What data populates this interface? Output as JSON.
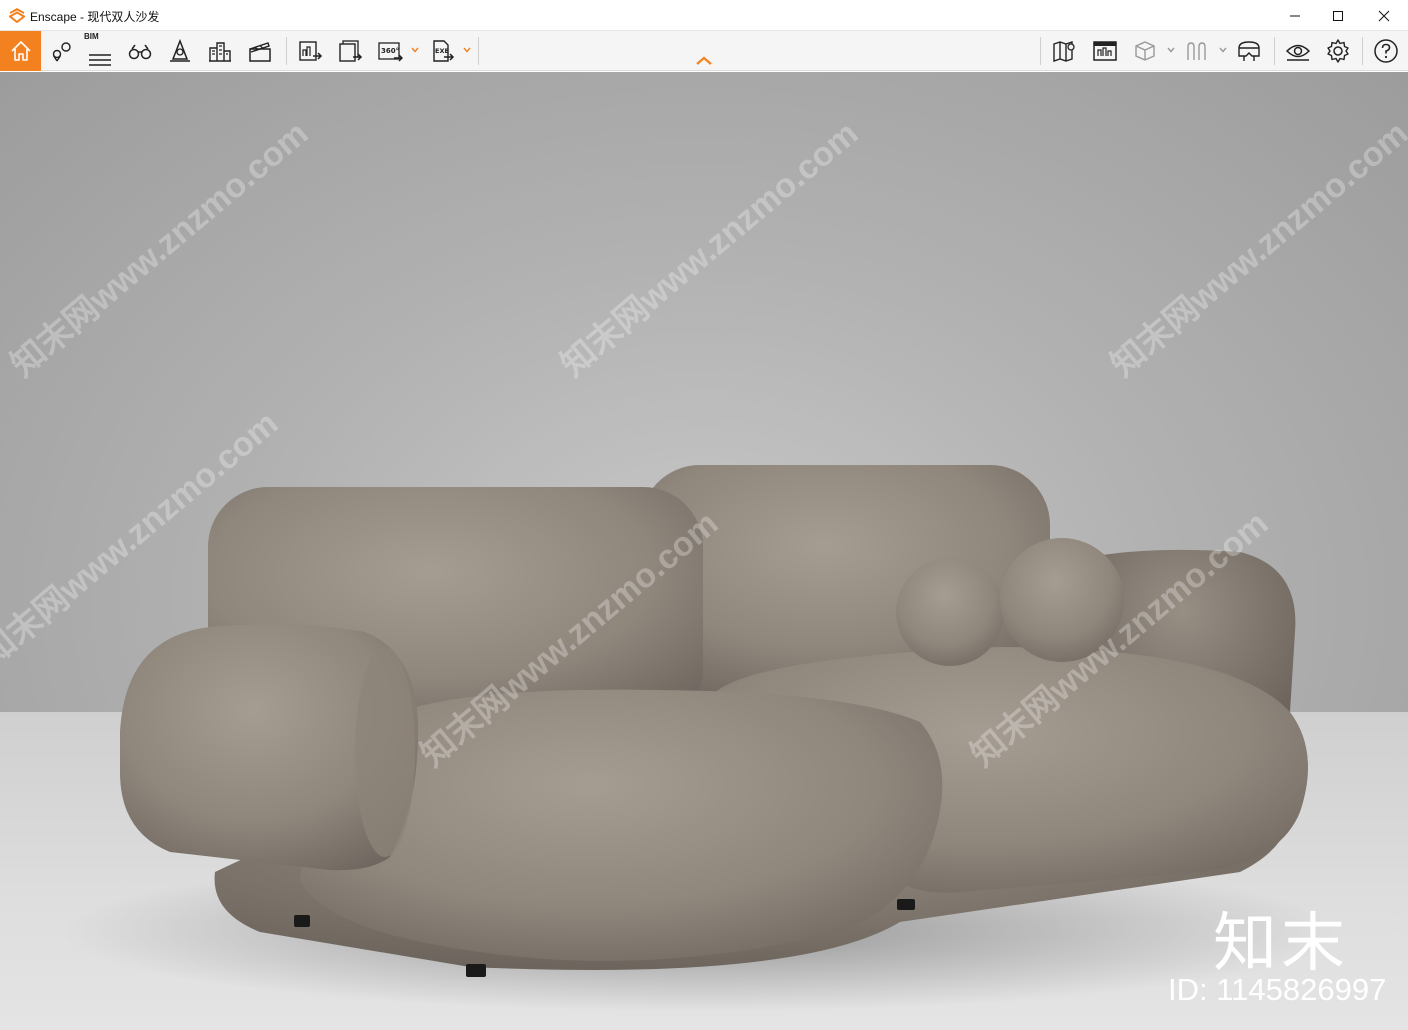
{
  "window": {
    "title": "Enscape - 现代双人沙发",
    "controls": {
      "minimize": "minimize-icon",
      "maximize": "maximize-icon",
      "close": "close-icon"
    }
  },
  "toolbar": {
    "left_tools": [
      {
        "name": "home-icon",
        "active": true
      },
      {
        "name": "location-pins-icon"
      },
      {
        "name": "bim-icon",
        "label": "BIM"
      },
      {
        "name": "binoculars-icon"
      },
      {
        "name": "traffic-cone-icon"
      },
      {
        "name": "buildings-icon"
      },
      {
        "name": "clapperboard-icon"
      },
      {
        "name": "render-screenshot-icon"
      },
      {
        "name": "batch-render-icon"
      },
      {
        "name": "export-360-icon",
        "label": "360°"
      },
      {
        "name": "export-exe-icon",
        "label": "EXE"
      }
    ],
    "right_tools": [
      {
        "name": "map-icon"
      },
      {
        "name": "web-standalone-icon"
      },
      {
        "name": "box-view-icon"
      },
      {
        "name": "sketch-view-icon"
      },
      {
        "name": "vr-headset-icon"
      },
      {
        "name": "visibility-eye-icon"
      },
      {
        "name": "settings-gear-icon"
      },
      {
        "name": "help-icon"
      }
    ],
    "accent_color": "#f48120"
  },
  "viewport": {
    "watermark_text": "知末网www.znzmo.com",
    "brand_mark": "知末",
    "brand_id": "ID: 1145826997"
  }
}
